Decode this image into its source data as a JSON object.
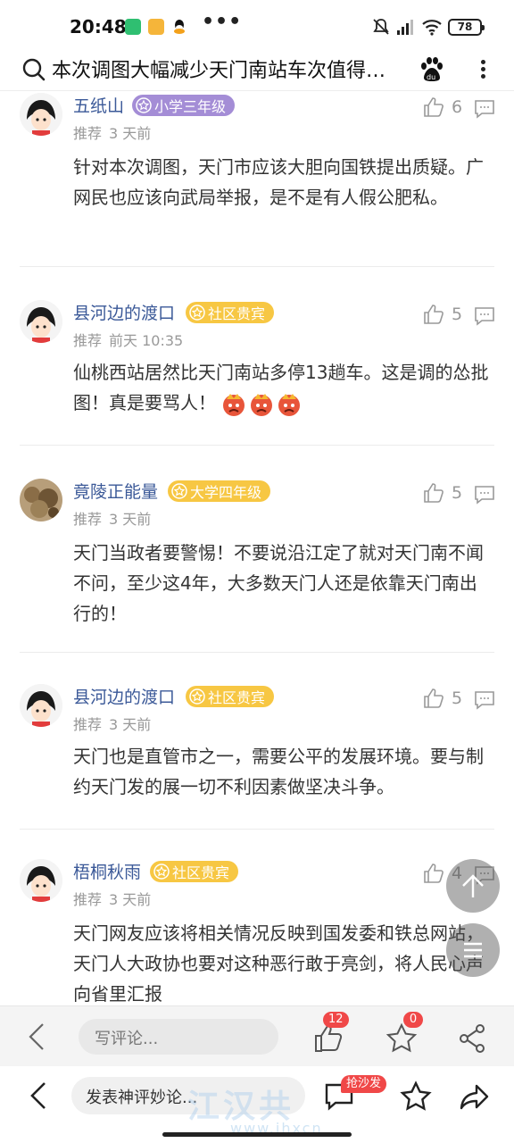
{
  "status_bar": {
    "time": "20:48",
    "dots": "•••",
    "battery": "78"
  },
  "search": {
    "query": "本次调图大幅减少天门南站车次值得…"
  },
  "comments": [
    {
      "user": "五纸山",
      "badge": "小学三年级",
      "tag": "推荐",
      "time": "3 天前",
      "likes": "6",
      "text": "针对本次调图，天门市应该大胆向国铁提出质疑。广网民也应该向武局举报，是不是有人假公肥私。"
    },
    {
      "user": "县河边的渡口",
      "badge": "社区贵宾",
      "tag": "推荐",
      "time": "前天 10:35",
      "likes": "5",
      "text": "仙桃西站居然比天门南站多停13趟车。这是调的怂批图！真是要骂人！"
    },
    {
      "user": "竟陵正能量",
      "badge": "大学四年级",
      "tag": "推荐",
      "time": "3 天前",
      "likes": "5",
      "text": "天门当政者要警惕！不要说沿江定了就对天门南不闻不问，至少这4年，大多数天门人还是依靠天门南出行的！"
    },
    {
      "user": "县河边的渡口",
      "badge": "社区贵宾",
      "tag": "推荐",
      "time": "3 天前",
      "likes": "5",
      "text": "天门也是直管市之一，需要公平的发展环境。要与制约天门发的展一切不利因素做坚决斗争。"
    },
    {
      "user": "梧桐秋雨",
      "badge": "社区贵宾",
      "tag": "推荐",
      "time": "3 天前",
      "likes": "4",
      "text": "天门网友应该将相关情况反映到国发委和铁总网站，天门人大政协也要对这种恶行敢于亮剑，将人民心声向省里汇报"
    }
  ],
  "comment_bar": {
    "placeholder": "写评论...",
    "like_count": "12",
    "fav_count": "0"
  },
  "nav_bar": {
    "placeholder": "发表神评妙论...",
    "sofa_badge": "抢沙发"
  },
  "watermark": {
    "text": "江汉共",
    "url": "www.jhxcn"
  }
}
